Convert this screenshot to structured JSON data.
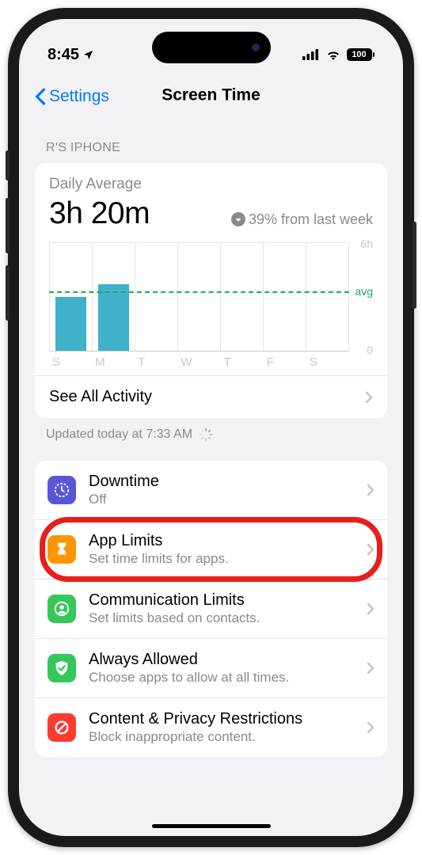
{
  "status": {
    "time": "8:45",
    "battery": "100"
  },
  "nav": {
    "back": "Settings",
    "title": "Screen Time"
  },
  "section_header": "R'S IPHONE",
  "daily": {
    "label": "Daily Average",
    "value": "3h 20m",
    "trend": "39% from last week",
    "y_top": "6h",
    "y_bottom": "0",
    "avg_label": "avg"
  },
  "see_all": "See All Activity",
  "updated": "Updated today at 7:33 AM",
  "chart_data": {
    "type": "bar",
    "categories": [
      "S",
      "M",
      "T",
      "W",
      "T",
      "F",
      "S"
    ],
    "values": [
      3.0,
      3.7,
      0,
      0,
      0,
      0,
      0
    ],
    "bar_heights_pct": [
      50,
      62,
      0,
      0,
      0,
      0,
      0
    ],
    "avg_line_pct": 55,
    "ylim": [
      0,
      6
    ],
    "ylabel_top": "6h",
    "ylabel_bottom": "0",
    "title": "Daily Average"
  },
  "settings": [
    {
      "key": "downtime",
      "label": "Downtime",
      "sub": "Off",
      "color": "#5856d8",
      "icon": "downtime"
    },
    {
      "key": "app-limits",
      "label": "App Limits",
      "sub": "Set time limits for apps.",
      "color": "#ff9500",
      "icon": "hourglass",
      "highlight": true
    },
    {
      "key": "communication-limits",
      "label": "Communication Limits",
      "sub": "Set limits based on contacts.",
      "color": "#34c759",
      "icon": "person"
    },
    {
      "key": "always-allowed",
      "label": "Always Allowed",
      "sub": "Choose apps to allow at all times.",
      "color": "#34c759",
      "icon": "check-shield"
    },
    {
      "key": "content-privacy",
      "label": "Content & Privacy Restrictions",
      "sub": "Block inappropriate content.",
      "color": "#ff3b30",
      "icon": "nosign"
    }
  ]
}
